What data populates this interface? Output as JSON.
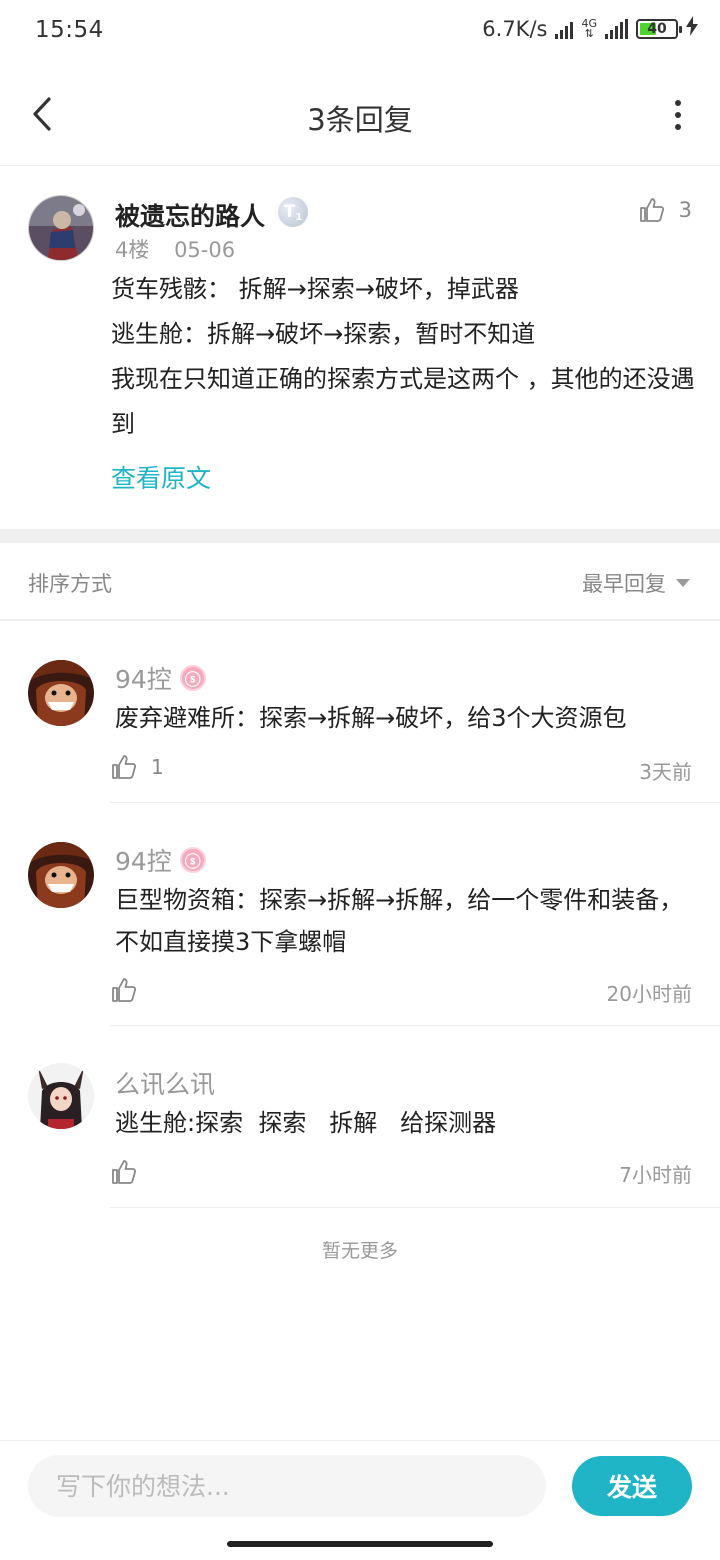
{
  "status_bar": {
    "time": "15:54",
    "net_speed": "6.7K/s",
    "network_type": "4G",
    "battery_level": "40",
    "battery_color": "#4fd12e"
  },
  "header": {
    "title": "3条回复",
    "back_icon": "chevron-left-icon",
    "more_icon": "vertical-dots-icon"
  },
  "post": {
    "author": "被遗忘的路人",
    "badge_icon": "level-t1-badge-icon",
    "floor": "4楼",
    "date": "05-06",
    "likes": "3",
    "lines": [
      "货车残骸： 拆解→探索→破坏，掉武器",
      "逃生舱：拆解→破坏→探索，暂时不知道",
      "我现在只知道正确的探索方式是这两个 ，其他的还没遇到"
    ],
    "view_original": "查看原文"
  },
  "sort": {
    "label": "排序方式",
    "selected": "最早回复"
  },
  "replies": [
    {
      "author": "94控",
      "text": "废弃避难所：探索→拆解→破坏，给3个大资源包",
      "likes": "1",
      "time": "3天前"
    },
    {
      "author": "94控",
      "text": "巨型物资箱：探索→拆解→拆解，给一个零件和装备，不如直接摸3下拿螺帽",
      "likes": "",
      "time": "20小时前"
    },
    {
      "author": "么讯么讯",
      "text": "逃生舱:探索  探索   拆解   给探测器",
      "likes": "",
      "time": "7小时前"
    }
  ],
  "footer": {
    "no_more": "暂无更多",
    "input_placeholder": "写下你的想法...",
    "send_label": "发送"
  },
  "colors": {
    "accent": "#1fb4c6",
    "divider": "#efefef"
  }
}
